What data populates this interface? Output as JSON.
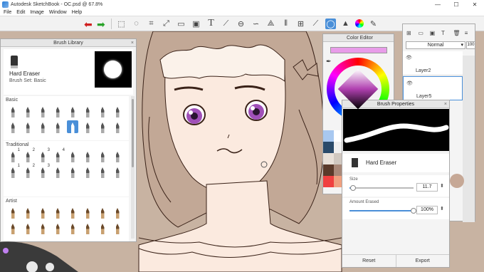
{
  "window": {
    "title": "Autodesk SketchBook - OC.psd @ 67.8%",
    "controls": [
      "—",
      "☐",
      "✕"
    ]
  },
  "menu": [
    "File",
    "Edit",
    "Image",
    "Window",
    "Help"
  ],
  "toolbar": {
    "tools": [
      "select-icon",
      "lasso-icon",
      "crop-icon",
      "transform-icon",
      "distort-icon",
      "fill-icon",
      "text-icon",
      "ruler-icon",
      "ellipse-guide-icon",
      "french-curve-icon",
      "perspective-icon",
      "symmetry-icon",
      "grid-icon",
      "stroke-icon",
      "circle-icon",
      "copic-icon",
      "color-wheel-icon",
      "brush-icon"
    ],
    "active_tool": "circle-icon"
  },
  "brush_library": {
    "title": "Brush Library",
    "close": "×",
    "current_brush": "Hard Eraser",
    "brush_set": "Brush Set: Basic",
    "sections": [
      {
        "name": "Basic",
        "count": 16,
        "numbers": []
      },
      {
        "name": "Traditional",
        "count": 16,
        "numbers": [
          "1",
          "2",
          "3",
          "4",
          "",
          "",
          "",
          "",
          "1",
          "2",
          "3",
          "",
          "",
          "",
          "",
          ""
        ]
      },
      {
        "name": "Artist",
        "count": 16,
        "numbers": []
      }
    ]
  },
  "color_editor": {
    "title": "Color Editor",
    "current_color": "#e89ce9",
    "swatches": [
      "#a8c8f0",
      "#ffffff",
      "#2a4a6a",
      "#f0f0f0",
      "#e8e0d8",
      "#d0c8c0",
      "#5a3a2a",
      "#a88878",
      "#f04040",
      "#f0a080"
    ]
  },
  "layers": {
    "blend_mode": "Normal",
    "opacity": "100",
    "items": [
      {
        "name": "Layer2"
      },
      {
        "name": "Layer5"
      }
    ]
  },
  "brush_properties": {
    "title": "Brush Properties",
    "close": "×",
    "brush_name": "Hard Eraser",
    "size_label": "Size",
    "size_value": "11.7",
    "size_fraction": 0.05,
    "amount_label": "Amount Erased",
    "amount_value": "100%",
    "amount_fraction": 1.0,
    "reset": "Reset",
    "export": "Export"
  },
  "colors": {
    "accent": "#4a8fd8",
    "canvas_bg": "#c8b3a2"
  }
}
